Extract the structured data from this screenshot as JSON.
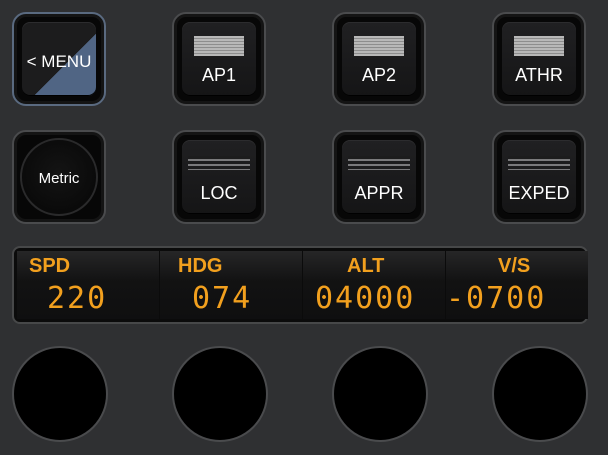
{
  "buttons": {
    "menu": "< MENU",
    "ap1": "AP1",
    "ap2": "AP2",
    "athr": "ATHR",
    "metric": "Metric",
    "loc": "LOC",
    "appr": "APPR",
    "exped": "EXPED"
  },
  "display": {
    "spd": {
      "name": "SPD",
      "value": "220"
    },
    "hdg": {
      "name": "HDG",
      "value": "074"
    },
    "alt": {
      "name": "ALT",
      "value": "04000"
    },
    "vs": {
      "name": "V/S",
      "value": "-0700"
    }
  },
  "colors": {
    "display_text": "#f2a01e",
    "menu_accent": "#506584",
    "background": "#2f3032"
  }
}
